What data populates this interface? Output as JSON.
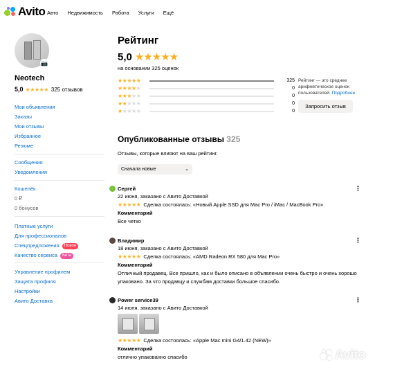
{
  "header": {
    "logo": "Avito",
    "nav": [
      "Авто",
      "Недвижимость",
      "Работа",
      "Услуги",
      "Ещё"
    ]
  },
  "seller": {
    "name": "Neotech",
    "rating": "5,0",
    "stars": "★★★★★",
    "reviews_count": "325 отзывов"
  },
  "sidebar": {
    "group1": [
      "Мои объявления",
      "Заказы",
      "Мои отзывы",
      "Избранное",
      "Резюме"
    ],
    "group2": [
      "Сообщения",
      "Уведомления"
    ],
    "wallet": {
      "label": "Кошелёк",
      "balance": "0 ₽",
      "bonuses": "0 бонусов"
    },
    "group3": [
      {
        "label": "Платные услуги"
      },
      {
        "label": "Для профессионалов"
      },
      {
        "label": "Спецпредложения",
        "badge": "Новое"
      },
      {
        "label": "Качество сервиса",
        "badge": "Бета"
      }
    ],
    "group4": [
      "Управление профилем",
      "Защита профиля",
      "Настройки",
      "Авито Доставка"
    ]
  },
  "rating_block": {
    "title": "Рейтинг",
    "value": "5,0",
    "stars": "★★★★★",
    "based_on": "на основании 325 оценок",
    "distribution": [
      {
        "stars": 5,
        "count": "325",
        "fraction": 1.0
      },
      {
        "stars": 4,
        "count": "0",
        "fraction": 0
      },
      {
        "stars": 3,
        "count": "0",
        "fraction": 0
      },
      {
        "stars": 2,
        "count": "0",
        "fraction": 0
      },
      {
        "stars": 1,
        "count": "0",
        "fraction": 0
      }
    ],
    "info_text": "Рейтинг — это среднее арифметическое оценок пользователей.",
    "info_link": "Подробнее",
    "request_button": "Запросить отзыв"
  },
  "reviews_section": {
    "title": "Опубликованные отзывы",
    "count": "325",
    "subtitle": "Отзывы, которые влияют на ваш рейтинг.",
    "sort_value": "Сначала новые"
  },
  "reviews": [
    {
      "name": "Сергей",
      "date": "22 июня, заказано с Авито Доставкой",
      "stars": "★★★★★",
      "deal": "Сделка состоялась: «Новый Apple SSD для Mac Pro / iMac / MacBook Pro»",
      "caption": "Комментарий",
      "text": "Все четко",
      "avatar_color": "#7cc242"
    },
    {
      "name": "Владимир",
      "date": "18 июня, заказано с Авито Доставкой",
      "stars": "★★★★★",
      "deal": "Сделка состоялась: «AMD Radeon RX 580 для Mac Pro»",
      "caption": "Комментарий",
      "text": "Отличный продавец. Все пришло, как и было описано в объявлении очень быстро и очень хорошо упаковано. За что продавцу и службам доставки большое спасибо.",
      "avatar_color": "#5a4a42"
    },
    {
      "name": "Power service39",
      "date": "14 июня, заказано с Авито Доставкой",
      "stars": "★★★★★",
      "deal": "Сделка состоялась: «Apple Mac mini G4/1.42 (NEW)»",
      "caption": "Комментарий",
      "text": "отлично упакованно спасибо",
      "avatar_color": "#2a2a2a"
    }
  ],
  "watermark": "Avito"
}
